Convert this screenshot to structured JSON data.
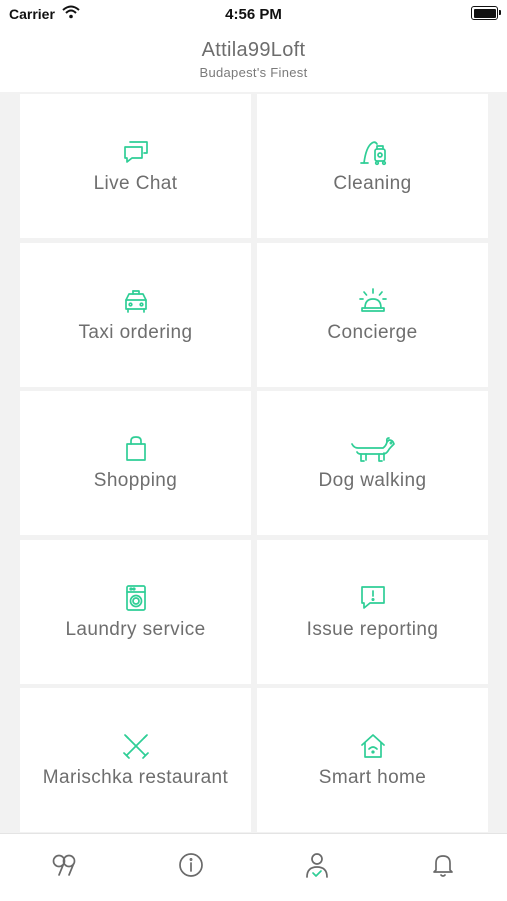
{
  "status_bar": {
    "carrier": "Carrier",
    "time": "4:56 PM"
  },
  "header": {
    "title": "Attila99Loft",
    "subtitle": "Budapest's Finest"
  },
  "accent_color": "#2fce96",
  "services": [
    {
      "label": "Live Chat",
      "icon": "chat-bubbles-icon"
    },
    {
      "label": "Cleaning",
      "icon": "vacuum-cleaner-icon"
    },
    {
      "label": "Taxi ordering",
      "icon": "taxi-icon"
    },
    {
      "label": "Concierge",
      "icon": "service-bell-icon"
    },
    {
      "label": "Shopping",
      "icon": "shopping-bag-icon"
    },
    {
      "label": "Dog walking",
      "icon": "dog-icon"
    },
    {
      "label": "Laundry service",
      "icon": "washing-machine-icon"
    },
    {
      "label": "Issue reporting",
      "icon": "alert-message-icon"
    },
    {
      "label": "Marischka restaurant",
      "icon": "crossed-utensils-icon"
    },
    {
      "label": "Smart home",
      "icon": "smart-home-icon"
    }
  ],
  "tab_bar": [
    {
      "icon": "quote-icon",
      "name": "tab-quotes"
    },
    {
      "icon": "info-icon",
      "name": "tab-info"
    },
    {
      "icon": "user-check-icon",
      "name": "tab-profile"
    },
    {
      "icon": "bell-icon",
      "name": "tab-notifications"
    }
  ]
}
